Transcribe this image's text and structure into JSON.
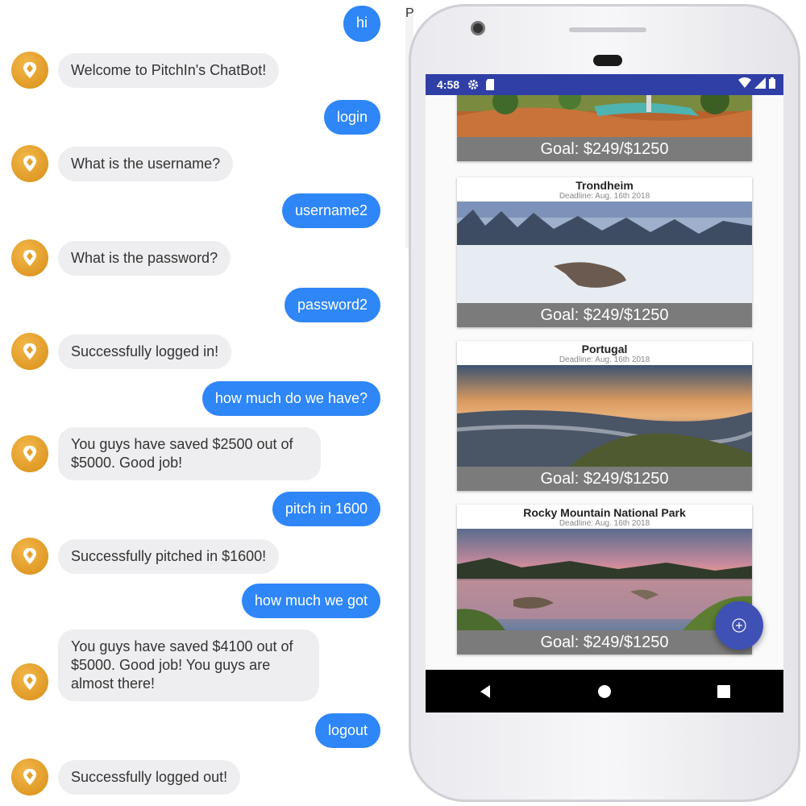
{
  "chat": {
    "messages": [
      {
        "from": "user",
        "text": "hi"
      },
      {
        "from": "bot",
        "text": "Welcome to PitchIn's ChatBot!"
      },
      {
        "from": "user",
        "text": "login"
      },
      {
        "from": "bot",
        "text": "What is the username?"
      },
      {
        "from": "user",
        "text": "username2"
      },
      {
        "from": "bot",
        "text": "What is the password?"
      },
      {
        "from": "user",
        "text": "password2"
      },
      {
        "from": "bot",
        "text": "Successfully logged in!"
      },
      {
        "from": "user",
        "text": "how much do we have?"
      },
      {
        "from": "bot",
        "text": "You guys have saved $2500 out of $5000. Good job!"
      },
      {
        "from": "user",
        "text": "pitch in 1600"
      },
      {
        "from": "bot",
        "text": "Successfully pitched in $1600!"
      },
      {
        "from": "user",
        "text": "how much we got"
      },
      {
        "from": "bot",
        "text": "You guys have saved $4100 out of $5000. Good job! You guys are almost there!"
      },
      {
        "from": "user",
        "text": "logout"
      },
      {
        "from": "bot",
        "text": "Successfully logged out!"
      }
    ],
    "colors": {
      "user_bubble": "#2e86f7",
      "bot_bubble": "#eeeef0",
      "avatar": "#e3a12f"
    },
    "avatar_icon": "location-pin-icon"
  },
  "window_fragment": {
    "title_partial": "Pi"
  },
  "phone": {
    "status_bar": {
      "time": "4:58",
      "icons_left": [
        "settings-icon",
        "sd-card-icon"
      ],
      "icons_right": [
        "wifi-icon",
        "signal-icon",
        "battery-icon"
      ],
      "color": "#2f3fa6"
    },
    "cards": [
      {
        "title": "",
        "deadline": "",
        "goal": "Goal: $249/$1250",
        "image": "desert-oasis-landscape"
      },
      {
        "title": "Trondheim",
        "deadline": "Deadline: Aug. 16th 2018",
        "goal": "Goal: $249/$1250",
        "image": "snowy-forest-landscape"
      },
      {
        "title": "Portugal",
        "deadline": "Deadline: Aug. 16th 2018",
        "goal": "Goal: $249/$1250",
        "image": "coastal-sunset-landscape"
      },
      {
        "title": "Rocky Mountain National Park",
        "deadline": "Deadline: Aug. 16th 2018",
        "goal": "Goal: $249/$1250",
        "image": "mountain-lake-sunset-landscape"
      }
    ],
    "fab_icon": "add-circle-icon",
    "fab_color": "#3f51b5",
    "nav": [
      "back-icon",
      "home-icon",
      "recents-icon"
    ]
  }
}
